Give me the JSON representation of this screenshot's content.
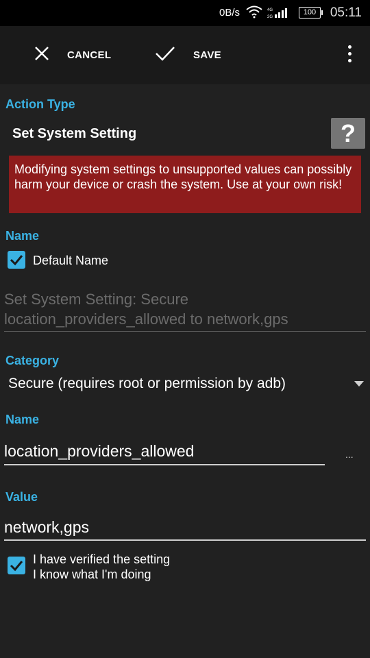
{
  "status_bar": {
    "net_speed": "0B/s",
    "battery": "100",
    "time": "05:11"
  },
  "toolbar": {
    "cancel_label": "CANCEL",
    "save_label": "SAVE"
  },
  "action_type": {
    "section_label": "Action Type",
    "value": "Set System Setting",
    "help_glyph": "?"
  },
  "warning_text": "Modifying system settings to unsupported values can possibly harm your device or crash the system. Use at your own risk!",
  "name_section": {
    "label": "Name",
    "default_name_label": "Default Name",
    "default_name_checked": true,
    "preview_line1": "Set System Setting: Secure",
    "preview_line2": "location_providers_allowed to network,gps"
  },
  "category": {
    "label": "Category",
    "selected": "Secure (requires root or permission by adb)"
  },
  "setting_name": {
    "label": "Name",
    "value": "location_providers_allowed",
    "picker_glyph": "..."
  },
  "setting_value": {
    "label": "Value",
    "value": "network,gps"
  },
  "verify": {
    "checked": true,
    "line1": "I have verified the setting",
    "line2": "I know what I'm doing"
  },
  "colors": {
    "accent": "#3ab2e3",
    "warning_bg": "#8e1c1c",
    "background": "#212121",
    "toolbar_bg": "#1a1a1a"
  }
}
